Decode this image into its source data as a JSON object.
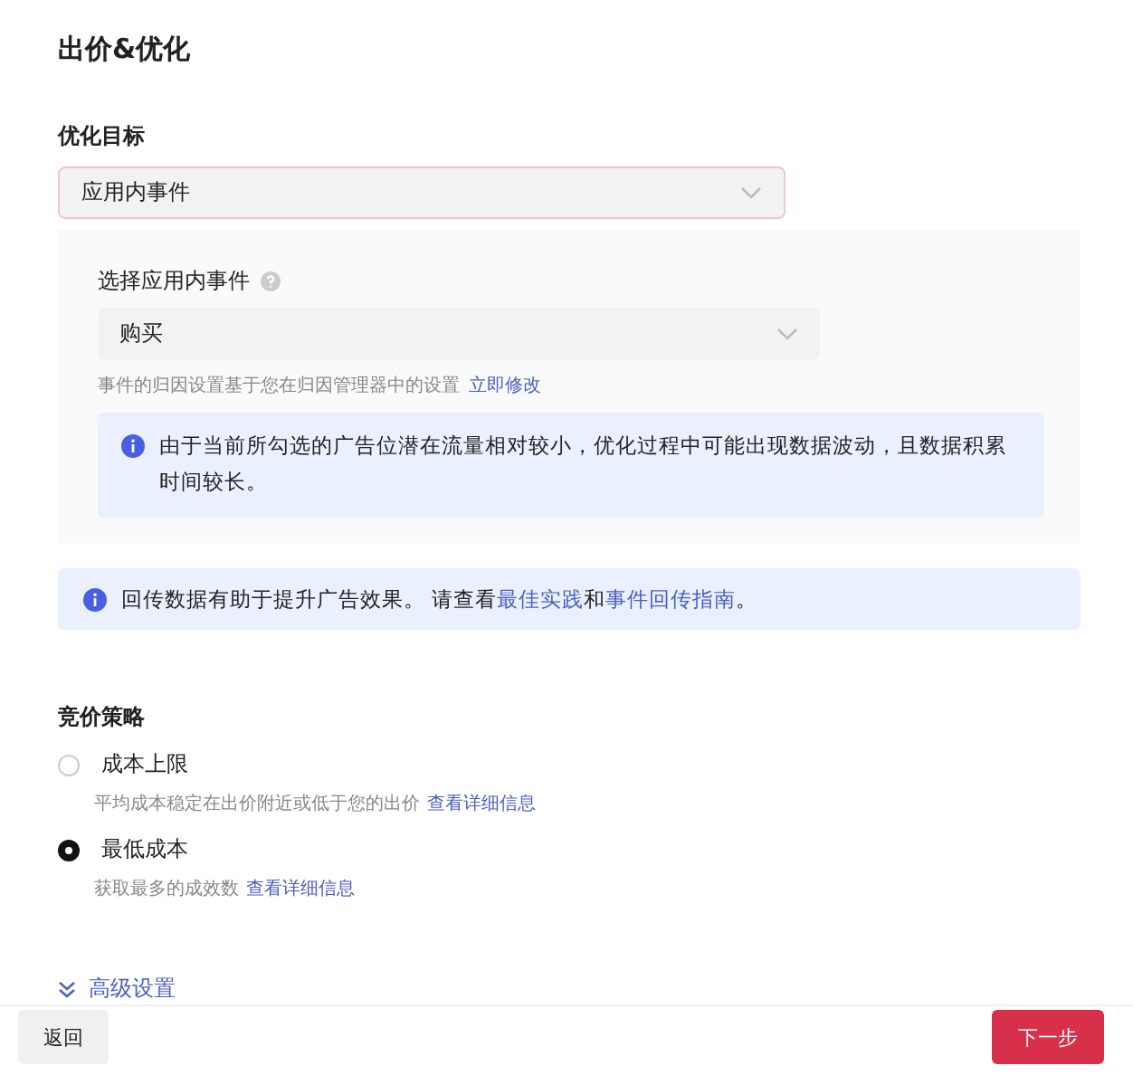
{
  "title": "出价&优化",
  "optimization_goal": {
    "label": "优化目标",
    "value": "应用内事件",
    "event": {
      "label": "选择应用内事件",
      "value": "购买",
      "hint": "事件的归因设置基于您在归因管理器中的设置",
      "hint_link": "立即修改",
      "notice": "由于当前所勾选的广告位潜在流量相对较小，优化过程中可能出现数据波动，且数据积累时间较长。"
    }
  },
  "callback_notice": {
    "parts": [
      {
        "kind": "text",
        "text": "回传数据有助于提升广告效果。 请查看"
      },
      {
        "kind": "link",
        "text": "最佳实践"
      },
      {
        "kind": "text",
        "text": "和"
      },
      {
        "kind": "link",
        "text": "事件回传指南"
      },
      {
        "kind": "text",
        "text": "。"
      }
    ]
  },
  "bid_strategy": {
    "label": "竞价策略",
    "options": [
      {
        "label": "成本上限",
        "selected": false,
        "description": "平均成本稳定在出价附近或低于您的出价",
        "link": "查看详细信息"
      },
      {
        "label": "最低成本",
        "selected": true,
        "description": "获取最多的成效数",
        "link": "查看详细信息"
      }
    ]
  },
  "advanced": "高级设置",
  "buttons": {
    "back": "返回",
    "next": "下一步"
  }
}
